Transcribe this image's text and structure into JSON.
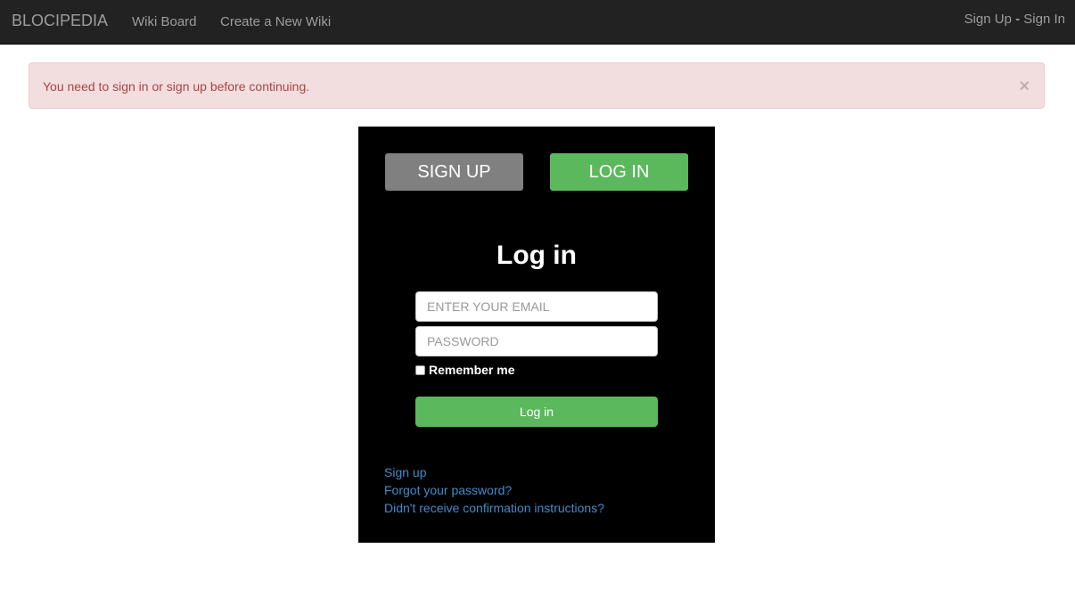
{
  "navbar": {
    "brand": "BLOCIPEDIA",
    "links": [
      "Wiki Board",
      "Create a New Wiki"
    ],
    "auth": {
      "sign_up": "Sign Up",
      "separator": "-",
      "sign_in": "Sign In"
    }
  },
  "alert": {
    "message": "You need to sign in or sign up before continuing.",
    "close": "×"
  },
  "panel": {
    "tabs": {
      "sign_up": "SIGN UP",
      "log_in": "LOG IN"
    },
    "heading": "Log in",
    "email_placeholder": "ENTER YOUR EMAIL",
    "email_value": "",
    "password_placeholder": "PASSWORD",
    "password_value": "",
    "remember_label": "Remember me",
    "remember_checked": false,
    "submit_label": "Log in",
    "links": [
      "Sign up",
      "Forgot your password?",
      "Didn't receive confirmation instructions?"
    ]
  },
  "colors": {
    "navbar_bg": "#222222",
    "alert_bg": "#f2dede",
    "alert_text": "#a94442",
    "panel_bg": "#000000",
    "primary_green": "#5cb85c",
    "tab_gray": "#808080",
    "link_blue": "#428bca"
  }
}
